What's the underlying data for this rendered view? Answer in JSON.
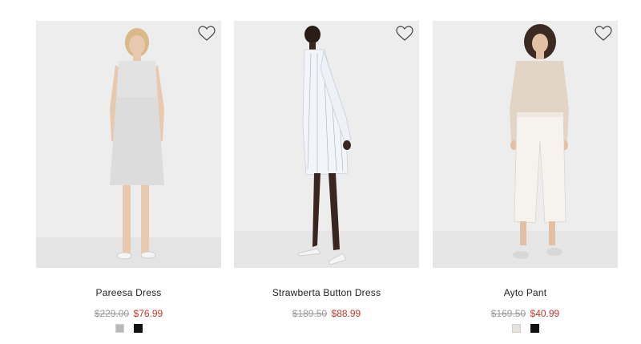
{
  "products": [
    {
      "name": "Pareesa Dress",
      "original_price": "$229.00",
      "sale_price": "$76.99",
      "swatch_colors": [
        "#b9b9b9",
        "#111111"
      ]
    },
    {
      "name": "Strawberta Button Dress",
      "original_price": "$189.50",
      "sale_price": "$88.99",
      "swatch_colors": []
    },
    {
      "name": "Ayto Pant",
      "original_price": "$169.50",
      "sale_price": "$40.99",
      "swatch_colors": [
        "#e6e2de",
        "#111111"
      ]
    }
  ],
  "icons": {
    "favorite": "heart-outline-icon"
  },
  "colors": {
    "sale": "#c0392b",
    "strikethrough": "#9a9a9a",
    "photo_background": "#ededed"
  }
}
